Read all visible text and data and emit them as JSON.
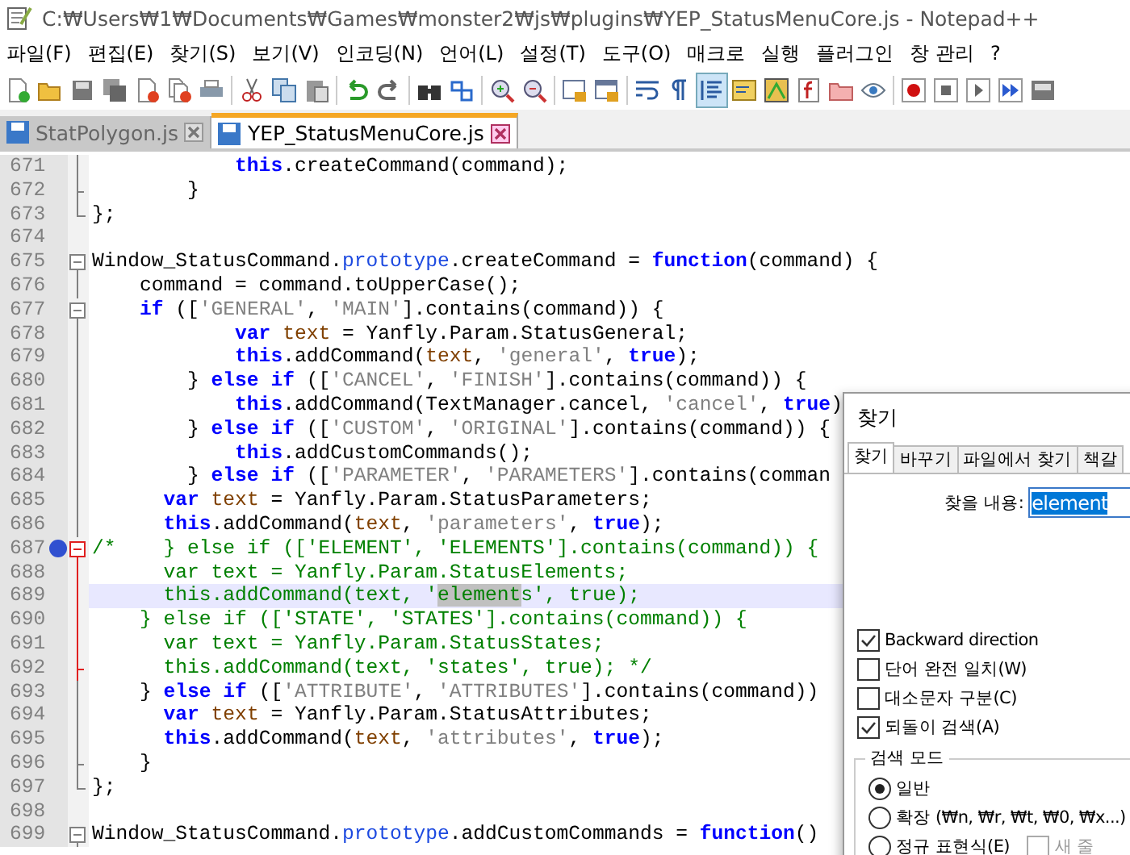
{
  "window": {
    "title": "C:₩Users₩1₩Documents₩Games₩monster2₩js₩plugins₩YEP_StatusMenuCore.js - Notepad++"
  },
  "menu": [
    "파일(F)",
    "편집(E)",
    "찾기(S)",
    "보기(V)",
    "인코딩(N)",
    "언어(L)",
    "설정(T)",
    "도구(O)",
    "매크로",
    "실행",
    "플러그인",
    "창 관리",
    "?"
  ],
  "toolbar": [
    {
      "kind": "new",
      "selected": false
    },
    {
      "kind": "open",
      "selected": false
    },
    {
      "kind": "save",
      "selected": false
    },
    {
      "kind": "save-all",
      "selected": false
    },
    {
      "kind": "close",
      "selected": false
    },
    {
      "kind": "close-all",
      "selected": false
    },
    {
      "kind": "print",
      "selected": false
    },
    {
      "kind": "sep"
    },
    {
      "kind": "cut",
      "selected": false
    },
    {
      "kind": "copy",
      "selected": false
    },
    {
      "kind": "paste",
      "selected": false
    },
    {
      "kind": "sep"
    },
    {
      "kind": "undo",
      "selected": false
    },
    {
      "kind": "redo",
      "selected": false
    },
    {
      "kind": "sep"
    },
    {
      "kind": "find",
      "selected": false
    },
    {
      "kind": "replace",
      "selected": false
    },
    {
      "kind": "sep"
    },
    {
      "kind": "zoom-in",
      "selected": false
    },
    {
      "kind": "zoom-out",
      "selected": false
    },
    {
      "kind": "sep"
    },
    {
      "kind": "sync-v",
      "selected": false
    },
    {
      "kind": "sync-h",
      "selected": false
    },
    {
      "kind": "sep"
    },
    {
      "kind": "wrap",
      "selected": false
    },
    {
      "kind": "pilcrow",
      "selected": false
    },
    {
      "kind": "indent",
      "selected": true
    },
    {
      "kind": "lang",
      "selected": false
    },
    {
      "kind": "map",
      "selected": false
    },
    {
      "kind": "func",
      "selected": false
    },
    {
      "kind": "folder",
      "selected": false
    },
    {
      "kind": "eye",
      "selected": false
    },
    {
      "kind": "sep"
    },
    {
      "kind": "record",
      "selected": false
    },
    {
      "kind": "stop",
      "selected": false
    },
    {
      "kind": "play",
      "selected": false
    },
    {
      "kind": "play-multi",
      "selected": false
    },
    {
      "kind": "save-macro",
      "selected": false
    }
  ],
  "tabs": [
    {
      "label": "StatPolygon.js",
      "selected": false
    },
    {
      "label": "YEP_StatusMenuCore.js",
      "selected": true
    }
  ],
  "editor": {
    "lines": [
      {
        "num": "671",
        "kind": "fold-body",
        "fold_active": false,
        "bookmark": false,
        "current": false,
        "tokens": [
          {
            "kind": "kw",
            "text": "            this"
          },
          {
            "kind": "plain",
            "text": ".createCommand(command);"
          }
        ]
      },
      {
        "num": "672",
        "kind": "fold-tail",
        "fold_active": false,
        "bookmark": false,
        "current": false,
        "tokens": [
          {
            "kind": "plain",
            "text": "        }"
          }
        ]
      },
      {
        "num": "673",
        "kind": "fold-end",
        "fold_active": false,
        "bookmark": false,
        "current": false,
        "tokens": [
          {
            "kind": "plain",
            "text": "};"
          }
        ]
      },
      {
        "num": "674",
        "kind": "plain",
        "bookmark": false,
        "current": false
      },
      {
        "num": "675",
        "kind": "fold-start",
        "fold_active": false,
        "bookmark": false,
        "current": false,
        "tokens": [
          {
            "kind": "plain",
            "text": "Window_StatusCommand."
          },
          {
            "kind": "type",
            "text": "prototype"
          },
          {
            "kind": "plain",
            "text": ".createCommand = "
          },
          {
            "kind": "kw",
            "text": "function"
          },
          {
            "kind": "plain",
            "text": "(command) {"
          }
        ]
      },
      {
        "num": "676",
        "kind": "fold-body",
        "fold_active": false,
        "bookmark": false,
        "current": false,
        "tokens": [
          {
            "kind": "plain",
            "text": "    command = command.toUpperCase();"
          }
        ]
      },
      {
        "num": "677",
        "kind": "fold-start",
        "fold_active": false,
        "bookmark": false,
        "current": false,
        "tokens": [
          {
            "kind": "kw",
            "text": "    if"
          },
          {
            "kind": "plain",
            "text": " (["
          },
          {
            "kind": "str",
            "text": "'GENERAL'"
          },
          {
            "kind": "plain",
            "text": ", "
          },
          {
            "kind": "str",
            "text": "'MAIN'"
          },
          {
            "kind": "plain",
            "text": "].contains(command)) {"
          }
        ]
      },
      {
        "num": "678",
        "kind": "fold-body",
        "fold_active": false,
        "bookmark": false,
        "current": false,
        "tokens": [
          {
            "kind": "kw",
            "text": "            var"
          },
          {
            "kind": "var",
            "text": " text"
          },
          {
            "kind": "plain",
            "text": " = Yanfly.Param.StatusGeneral;"
          }
        ]
      },
      {
        "num": "679",
        "kind": "fold-body",
        "fold_active": false,
        "bookmark": false,
        "current": false,
        "tokens": [
          {
            "kind": "kw",
            "text": "            this"
          },
          {
            "kind": "plain",
            "text": ".addCommand("
          },
          {
            "kind": "var",
            "text": "text"
          },
          {
            "kind": "plain",
            "text": ", "
          },
          {
            "kind": "str",
            "text": "'general'"
          },
          {
            "kind": "plain",
            "text": ", "
          },
          {
            "kind": "kw",
            "text": "true"
          },
          {
            "kind": "plain",
            "text": ");"
          }
        ]
      },
      {
        "num": "680",
        "kind": "fold-body",
        "fold_active": false,
        "bookmark": false,
        "current": false,
        "tokens": [
          {
            "kind": "plain",
            "text": "        } "
          },
          {
            "kind": "kw",
            "text": "else if"
          },
          {
            "kind": "plain",
            "text": " (["
          },
          {
            "kind": "str",
            "text": "'CANCEL'"
          },
          {
            "kind": "plain",
            "text": ", "
          },
          {
            "kind": "str",
            "text": "'FINISH'"
          },
          {
            "kind": "plain",
            "text": "].contains(command)) {"
          }
        ]
      },
      {
        "num": "681",
        "kind": "fold-body",
        "fold_active": false,
        "bookmark": false,
        "current": false,
        "tokens": [
          {
            "kind": "kw",
            "text": "            this"
          },
          {
            "kind": "plain",
            "text": ".addCommand(TextManager.cancel, "
          },
          {
            "kind": "str",
            "text": "'cancel'"
          },
          {
            "kind": "plain",
            "text": ", "
          },
          {
            "kind": "kw",
            "text": "true"
          },
          {
            "kind": "plain",
            "text": ")"
          }
        ]
      },
      {
        "num": "682",
        "kind": "fold-body",
        "fold_active": false,
        "bookmark": false,
        "current": false,
        "tokens": [
          {
            "kind": "plain",
            "text": "        } "
          },
          {
            "kind": "kw",
            "text": "else if"
          },
          {
            "kind": "plain",
            "text": " (["
          },
          {
            "kind": "str",
            "text": "'CUSTOM'"
          },
          {
            "kind": "plain",
            "text": ", "
          },
          {
            "kind": "str",
            "text": "'ORIGINAL'"
          },
          {
            "kind": "plain",
            "text": "].contains(command)) {"
          }
        ]
      },
      {
        "num": "683",
        "kind": "fold-body",
        "fold_active": false,
        "bookmark": false,
        "current": false,
        "tokens": [
          {
            "kind": "kw",
            "text": "            this"
          },
          {
            "kind": "plain",
            "text": ".addCustomCommands();"
          }
        ]
      },
      {
        "num": "684",
        "kind": "fold-body",
        "fold_active": false,
        "bookmark": false,
        "current": false,
        "tokens": [
          {
            "kind": "plain",
            "text": "        } "
          },
          {
            "kind": "kw",
            "text": "else if"
          },
          {
            "kind": "plain",
            "text": " (["
          },
          {
            "kind": "str",
            "text": "'PARAMETER'"
          },
          {
            "kind": "plain",
            "text": ", "
          },
          {
            "kind": "str",
            "text": "'PARAMETERS'"
          },
          {
            "kind": "plain",
            "text": "].contains(comman"
          }
        ]
      },
      {
        "num": "685",
        "kind": "fold-body",
        "fold_active": false,
        "bookmark": false,
        "current": false,
        "tokens": [
          {
            "kind": "kw",
            "text": "      var"
          },
          {
            "kind": "var",
            "text": " text"
          },
          {
            "kind": "plain",
            "text": " = Yanfly.Param.StatusParameters;"
          }
        ]
      },
      {
        "num": "686",
        "kind": "fold-body",
        "fold_active": false,
        "bookmark": false,
        "current": false,
        "tokens": [
          {
            "kind": "kw",
            "text": "      this"
          },
          {
            "kind": "plain",
            "text": ".addCommand("
          },
          {
            "kind": "var",
            "text": "text"
          },
          {
            "kind": "plain",
            "text": ", "
          },
          {
            "kind": "str",
            "text": "'parameters'"
          },
          {
            "kind": "plain",
            "text": ", "
          },
          {
            "kind": "kw",
            "text": "true"
          },
          {
            "kind": "plain",
            "text": ");"
          }
        ]
      },
      {
        "num": "687",
        "kind": "fold-start",
        "fold_active": true,
        "bookmark": true,
        "current": false,
        "tokens": [
          {
            "kind": "comment",
            "text": "/*    } else if (['ELEMENT', 'ELEMENTS'].contains(command)) {"
          }
        ]
      },
      {
        "num": "688",
        "kind": "fold-body",
        "fold_active": true,
        "bookmark": false,
        "current": false,
        "tokens": [
          {
            "kind": "comment",
            "text": "      var text = Yanfly.Param.StatusElements;"
          }
        ]
      },
      {
        "num": "689",
        "kind": "fold-body",
        "fold_active": true,
        "bookmark": false,
        "current": true,
        "tokens": [
          {
            "kind": "comment",
            "text": "      this.addCommand(text, '"
          },
          {
            "kind": "match",
            "text": "element"
          },
          {
            "kind": "comment",
            "text": "s', true);"
          }
        ]
      },
      {
        "num": "690",
        "kind": "fold-body",
        "fold_active": true,
        "bookmark": false,
        "current": false,
        "tokens": [
          {
            "kind": "comment",
            "text": "    } else if (['STATE', 'STATES'].contains(command)) {"
          }
        ]
      },
      {
        "num": "691",
        "kind": "fold-body",
        "fold_active": true,
        "bookmark": false,
        "current": false,
        "tokens": [
          {
            "kind": "comment",
            "text": "      var text = Yanfly.Param.StatusStates;"
          }
        ]
      },
      {
        "num": "692",
        "kind": "fold-tail",
        "fold_active": true,
        "bookmark": false,
        "current": false,
        "tokens": [
          {
            "kind": "comment",
            "text": "      this.addCommand(text, 'states', true); */"
          }
        ]
      },
      {
        "num": "693",
        "kind": "fold-body",
        "fold_active": false,
        "bookmark": false,
        "current": false,
        "tokens": [
          {
            "kind": "plain",
            "text": "    } "
          },
          {
            "kind": "kw",
            "text": "else if"
          },
          {
            "kind": "plain",
            "text": " (["
          },
          {
            "kind": "str",
            "text": "'ATTRIBUTE'"
          },
          {
            "kind": "plain",
            "text": ", "
          },
          {
            "kind": "str",
            "text": "'ATTRIBUTES'"
          },
          {
            "kind": "plain",
            "text": "].contains(command))"
          }
        ]
      },
      {
        "num": "694",
        "kind": "fold-body",
        "fold_active": false,
        "bookmark": false,
        "current": false,
        "tokens": [
          {
            "kind": "kw",
            "text": "      var"
          },
          {
            "kind": "var",
            "text": " text"
          },
          {
            "kind": "plain",
            "text": " = Yanfly.Param.StatusAttributes;"
          }
        ]
      },
      {
        "num": "695",
        "kind": "fold-body",
        "fold_active": false,
        "bookmark": false,
        "current": false,
        "tokens": [
          {
            "kind": "kw",
            "text": "      this"
          },
          {
            "kind": "plain",
            "text": ".addCommand("
          },
          {
            "kind": "var",
            "text": "text"
          },
          {
            "kind": "plain",
            "text": ", "
          },
          {
            "kind": "str",
            "text": "'attributes'"
          },
          {
            "kind": "plain",
            "text": ", "
          },
          {
            "kind": "kw",
            "text": "true"
          },
          {
            "kind": "plain",
            "text": ");"
          }
        ]
      },
      {
        "num": "696",
        "kind": "fold-tail",
        "fold_active": false,
        "bookmark": false,
        "current": false,
        "tokens": [
          {
            "kind": "plain",
            "text": "    }"
          }
        ]
      },
      {
        "num": "697",
        "kind": "fold-end",
        "fold_active": false,
        "bookmark": false,
        "current": false,
        "tokens": [
          {
            "kind": "plain",
            "text": "};"
          }
        ]
      },
      {
        "num": "698",
        "kind": "plain",
        "bookmark": false,
        "current": false
      },
      {
        "num": "699",
        "kind": "fold-start",
        "fold_active": false,
        "bookmark": false,
        "current": false,
        "tokens": [
          {
            "kind": "plain",
            "text": "Window_StatusCommand."
          },
          {
            "kind": "type",
            "text": "prototype"
          },
          {
            "kind": "plain",
            "text": ".addCustomCommands = "
          },
          {
            "kind": "kw",
            "text": "function"
          },
          {
            "kind": "plain",
            "text": "()"
          }
        ]
      }
    ]
  },
  "find_dialog": {
    "title": "찾기",
    "tabs": [
      {
        "label": "찾기",
        "selected": true
      },
      {
        "label": "바꾸기",
        "selected": false
      },
      {
        "label": "파일에서 찾기",
        "selected": false
      },
      {
        "label": "책갈",
        "selected": false
      }
    ],
    "find_label": "찾을 내용:",
    "find_value": "element",
    "options": [
      {
        "label": "Backward direction",
        "checked": true
      },
      {
        "label": "단어 완전 일치(W)",
        "checked": false
      },
      {
        "label": "대소문자 구분(C)",
        "checked": false
      },
      {
        "label": "되돌이 검색(A)",
        "checked": true
      }
    ],
    "search_mode": {
      "title": "검색 모드",
      "modes": [
        {
          "label": "일반",
          "selected": true
        },
        {
          "label": "확장 (₩n, ₩r, ₩t, ₩0, ₩x...)",
          "selected": false
        },
        {
          "label": "정규 표현식(E)",
          "selected": false
        }
      ],
      "newline_option": {
        "label": "새 줄",
        "checked": false
      }
    }
  }
}
